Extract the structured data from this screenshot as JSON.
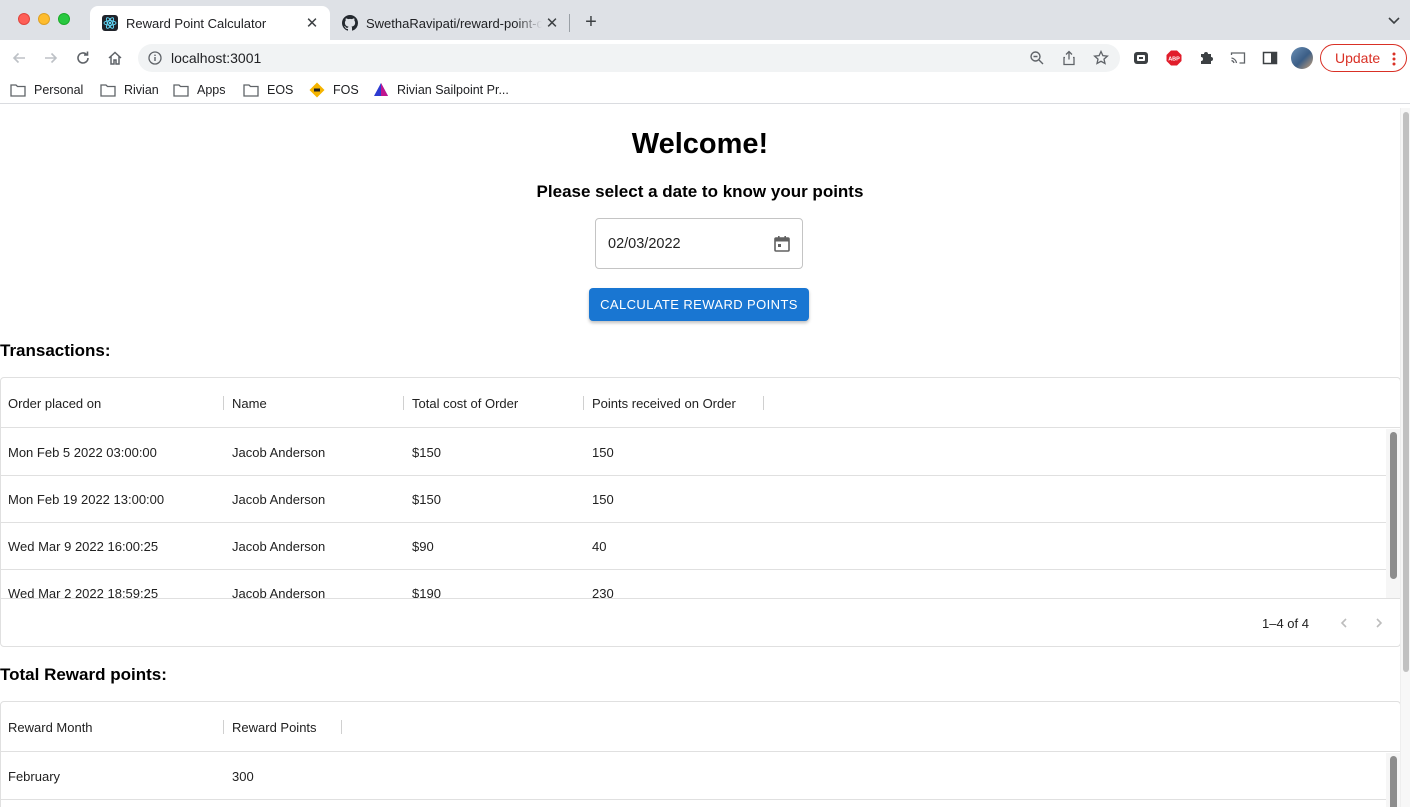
{
  "browser": {
    "tabs": [
      {
        "title": "Reward Point Calculator",
        "icon": "react-icon",
        "active": true
      },
      {
        "title": "SwethaRavipati/reward-point-calculator",
        "icon": "github-icon",
        "active": false
      }
    ],
    "url": "localhost:3001",
    "update_label": "Update",
    "bookmarks": [
      {
        "label": "Personal",
        "icon": "folder-icon"
      },
      {
        "label": "Rivian",
        "icon": "folder-icon"
      },
      {
        "label": "Apps",
        "icon": "folder-icon"
      },
      {
        "label": "EOS",
        "icon": "folder-icon"
      },
      {
        "label": "FOS",
        "icon": "fos-icon"
      },
      {
        "label": "Rivian Sailpoint Pr...",
        "icon": "sailpoint-icon"
      }
    ],
    "extensions": [
      {
        "name": "extension-icon"
      },
      {
        "name": "adblock-icon",
        "label": "ABP"
      },
      {
        "name": "puzzle-icon"
      },
      {
        "name": "cast-icon"
      },
      {
        "name": "sidepanel-icon"
      }
    ],
    "colors": {
      "tabstrip": "#dee1e6",
      "update": "#d93025"
    }
  },
  "page": {
    "title": "Welcome!",
    "subtitle": "Please select a date to know your points",
    "date_value": "02/03/2022",
    "button_label": "CALCULATE REWARD POINTS",
    "accent": "#1976d2"
  },
  "transactions": {
    "title": "Transactions:",
    "columns": [
      "Order placed on",
      "Name",
      "Total cost of Order",
      "Points received on Order"
    ],
    "rows": [
      [
        "Mon Feb 5 2022 03:00:00",
        "Jacob Anderson",
        "$150",
        "150"
      ],
      [
        "Mon Feb 19 2022 13:00:00",
        "Jacob Anderson",
        "$150",
        "150"
      ],
      [
        "Wed Mar 9 2022 16:00:25",
        "Jacob Anderson",
        "$90",
        "40"
      ],
      [
        "Wed Mar 2 2022 18:59:25",
        "Jacob Anderson",
        "$190",
        "230"
      ]
    ],
    "pagination": "1–4 of 4"
  },
  "rewards": {
    "title": "Total Reward points:",
    "columns": [
      "Reward Month",
      "Reward Points"
    ],
    "rows": [
      [
        "February",
        "300"
      ]
    ]
  }
}
